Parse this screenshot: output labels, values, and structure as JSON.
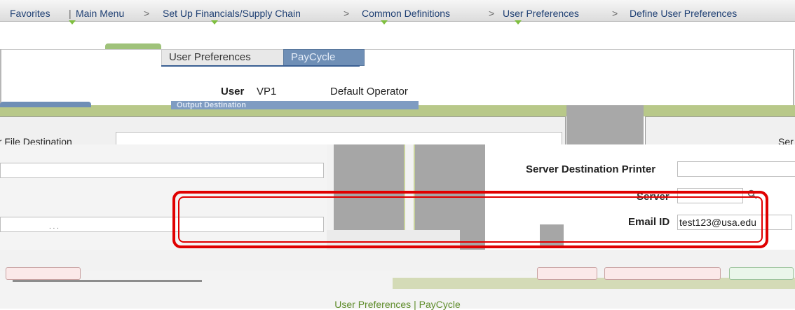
{
  "nav": {
    "items": [
      "Favorites",
      "Main Menu",
      "Set Up Financials/Supply Chain",
      "Common Definitions",
      "User Preferences",
      "Define User Preferences"
    ],
    "separator": ">"
  },
  "tabs": {
    "user_preferences": "User Preferences",
    "paycycle": "PayCycle"
  },
  "user": {
    "label": "User",
    "id": "VP1",
    "description": "Default Operator"
  },
  "group": {
    "title": "Output Destination"
  },
  "fields": {
    "file_destination_label": "er File Destination",
    "server_truncated": "Ser",
    "server_destination_printer_label": "Server Destination Printer",
    "server_label": "Server",
    "email_id_label": "Email ID",
    "email_id_value": "test123@usa.edu"
  },
  "footer": {
    "link_user_preferences": "User Preferences",
    "link_separator": "|",
    "link_paycycle": "PayCycle"
  },
  "colors": {
    "highlight": "#e00000",
    "nav_text": "#1e3f73",
    "footer_link": "#5e8c2a",
    "active_tab": "#6f8fb6"
  },
  "icons": {
    "server_lookup": "search-icon"
  }
}
